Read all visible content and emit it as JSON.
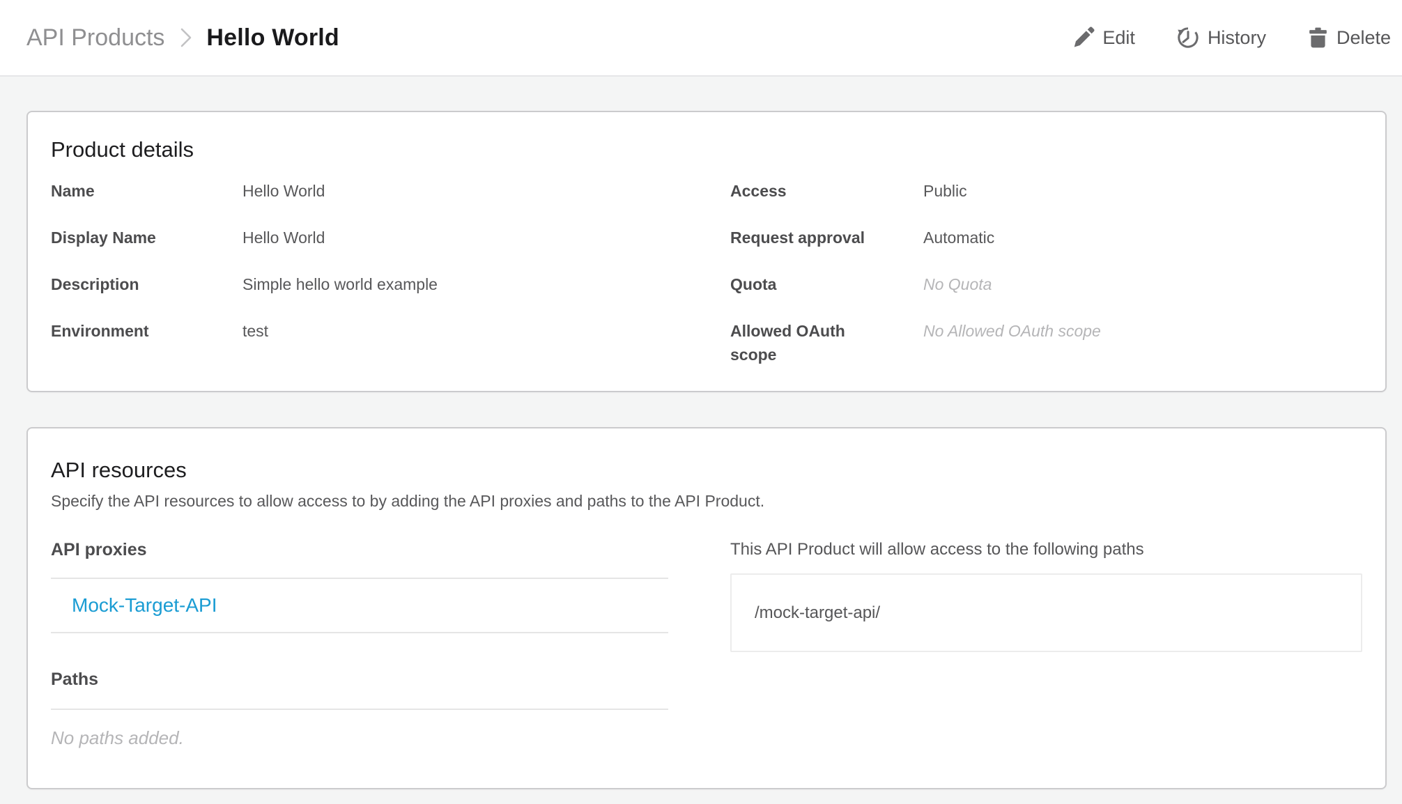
{
  "colors": {
    "background": "#f4f5f5",
    "link": "#1a9cd3",
    "icon": "#6b6b6d",
    "muted_text": "#b5b5b7"
  },
  "icons": {
    "breadcrumb_separator": "chevron-right-icon",
    "edit": "pencil-icon",
    "history": "history-clock-icon",
    "delete": "trash-icon"
  },
  "header": {
    "breadcrumb": {
      "parent": "API Products",
      "current": "Hello World"
    },
    "actions": {
      "edit": "Edit",
      "history": "History",
      "delete": "Delete"
    }
  },
  "product_details": {
    "title": "Product details",
    "left_rows": [
      {
        "label": "Name",
        "value": "Hello World"
      },
      {
        "label": "Display Name",
        "value": "Hello World"
      },
      {
        "label": "Description",
        "value": "Simple hello world example"
      },
      {
        "label": "Environment",
        "value": "test"
      }
    ],
    "right_rows": [
      {
        "label": "Access",
        "value": "Public",
        "muted": false
      },
      {
        "label": "Request approval",
        "value": "Automatic",
        "muted": false
      },
      {
        "label": "Quota",
        "value": "No Quota",
        "muted": true
      },
      {
        "label": "Allowed OAuth scope",
        "value": "No Allowed OAuth scope",
        "muted": true
      }
    ]
  },
  "api_resources": {
    "title": "API resources",
    "subtitle": "Specify the API resources to allow access to by adding the API proxies and paths to the API Product.",
    "proxies": {
      "title": "API proxies",
      "items": [
        "Mock-Target-API"
      ]
    },
    "paths": {
      "title": "Paths",
      "empty": "No paths added."
    },
    "allowed_paths": {
      "title": "This API Product will allow access to the following paths",
      "items": [
        "/mock-target-api/"
      ]
    }
  }
}
